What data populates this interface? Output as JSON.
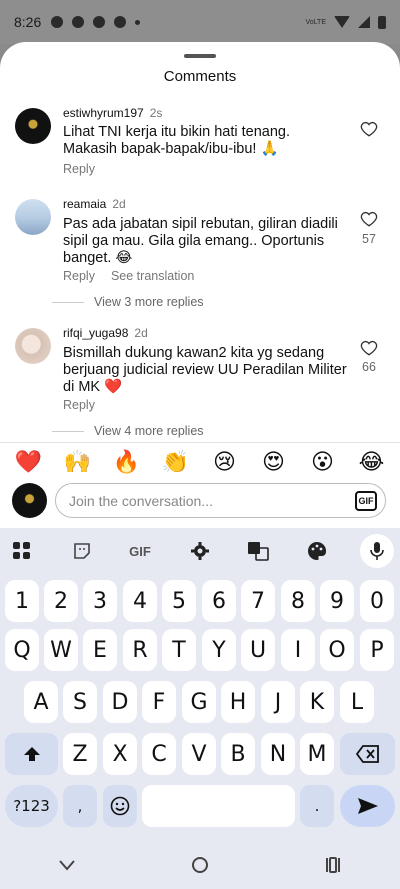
{
  "status_bar": {
    "time": "8:26",
    "volte": "VoLTE"
  },
  "sheet": {
    "title": "Comments"
  },
  "comments": [
    {
      "username": "estiwhyrum197",
      "time": "2s",
      "text": "Lihat TNI kerja itu bikin hati tenang. Makasih bapak-bapak/ibu-ibu! 🙏",
      "reply": "Reply",
      "likes": ""
    },
    {
      "username": "reamaia",
      "time": "2d",
      "text": "Pas ada jabatan sipil rebutan, giliran diadili sipil ga mau. Gila gila emang.. Oportunis banget. 😂",
      "reply": "Reply",
      "see_translation": "See translation",
      "likes": "57",
      "view_replies": "View 3 more replies"
    },
    {
      "username": "rifqi_yuga98",
      "time": "2d",
      "text": "Bismillah dukung kawan2 kita yg sedang berjuang judicial review UU Peradilan Militer di MK ❤️",
      "reply": "Reply",
      "likes": "66",
      "view_replies": "View 4 more replies"
    }
  ],
  "emoji_bar": [
    "❤️",
    "🙌",
    "🔥",
    "👏",
    "😢",
    "😍",
    "😮",
    "😂"
  ],
  "composer": {
    "placeholder": "Join the conversation...",
    "gif": "GIF"
  },
  "keyboard": {
    "toolbar": {
      "gif": "GIF"
    },
    "row_numbers": [
      "1",
      "2",
      "3",
      "4",
      "5",
      "6",
      "7",
      "8",
      "9",
      "0"
    ],
    "row1": [
      "Q",
      "W",
      "E",
      "R",
      "T",
      "Y",
      "U",
      "I",
      "O",
      "P"
    ],
    "row2": [
      "A",
      "S",
      "D",
      "F",
      "G",
      "H",
      "J",
      "K",
      "L"
    ],
    "row3": [
      "Z",
      "X",
      "C",
      "V",
      "B",
      "N",
      "M"
    ],
    "symbols": "?123",
    "comma": ",",
    "period": "."
  },
  "icons": {
    "heart": "heart-outline-icon",
    "shift": "shift-icon",
    "backspace": "backspace-icon",
    "enter": "send-arrow-icon",
    "emoji": "emoji-icon",
    "mic": "microphone-icon",
    "settings": "gear-icon",
    "translate": "translate-icon",
    "palette": "palette-icon",
    "apps": "grid-icon",
    "sticker": "sticker-icon"
  }
}
